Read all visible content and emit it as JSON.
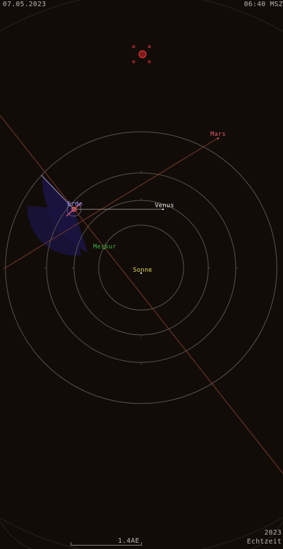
{
  "header": {
    "date": "07.05.2023",
    "time": "06:40 MSZ"
  },
  "footer": {
    "year": "2023",
    "mode": "Echtzeit",
    "scale": "1.4AE"
  },
  "planets": {
    "mars": "Mars",
    "venus": "Venus",
    "erde": "Erde",
    "merkur": "Merkur",
    "sonne": "Sonne"
  },
  "colors": {
    "background": "#120c08",
    "orbit": "#5a5550",
    "mars": "#e05a6a",
    "venus": "#e8e4dc",
    "erde": "#8a8aff",
    "merkur": "#3fae3f",
    "sonne": "#e0dc5a",
    "sector": "#1a1440"
  },
  "icons": {
    "mars_symbol": "mars-symbol-icon",
    "sun_marker": "sun-dot-icon"
  }
}
